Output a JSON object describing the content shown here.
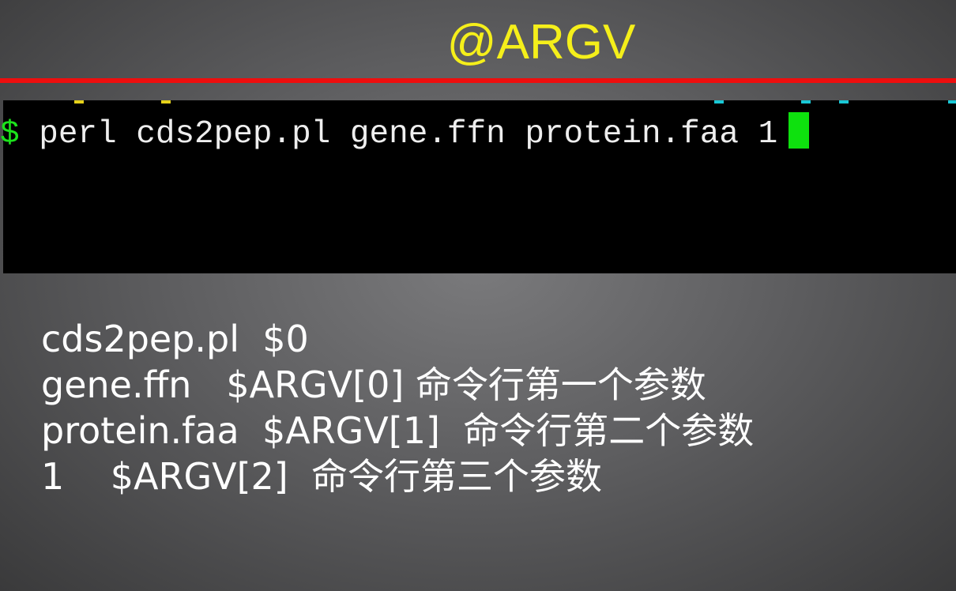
{
  "slide": {
    "title": "@ARGV",
    "accent_color": "#ee0e0e",
    "title_color": "#f5ef1a"
  },
  "terminal": {
    "prompt": "$",
    "command": "perl cds2pep.pl gene.ffn protein.faa 1",
    "cursor_color": "#0ee10e"
  },
  "explanations": [
    {
      "arg": "cds2pep.pl",
      "var": "$0",
      "desc": ""
    },
    {
      "arg": "gene.ffn",
      "var": "$ARGV[0]",
      "desc": "命令行第一个参数"
    },
    {
      "arg": "protein.faa",
      "var": "$ARGV[1]",
      "desc": "命令行第二个参数"
    },
    {
      "arg": "1",
      "var": "$ARGV[2]",
      "desc": "命令行第三个参数"
    }
  ]
}
